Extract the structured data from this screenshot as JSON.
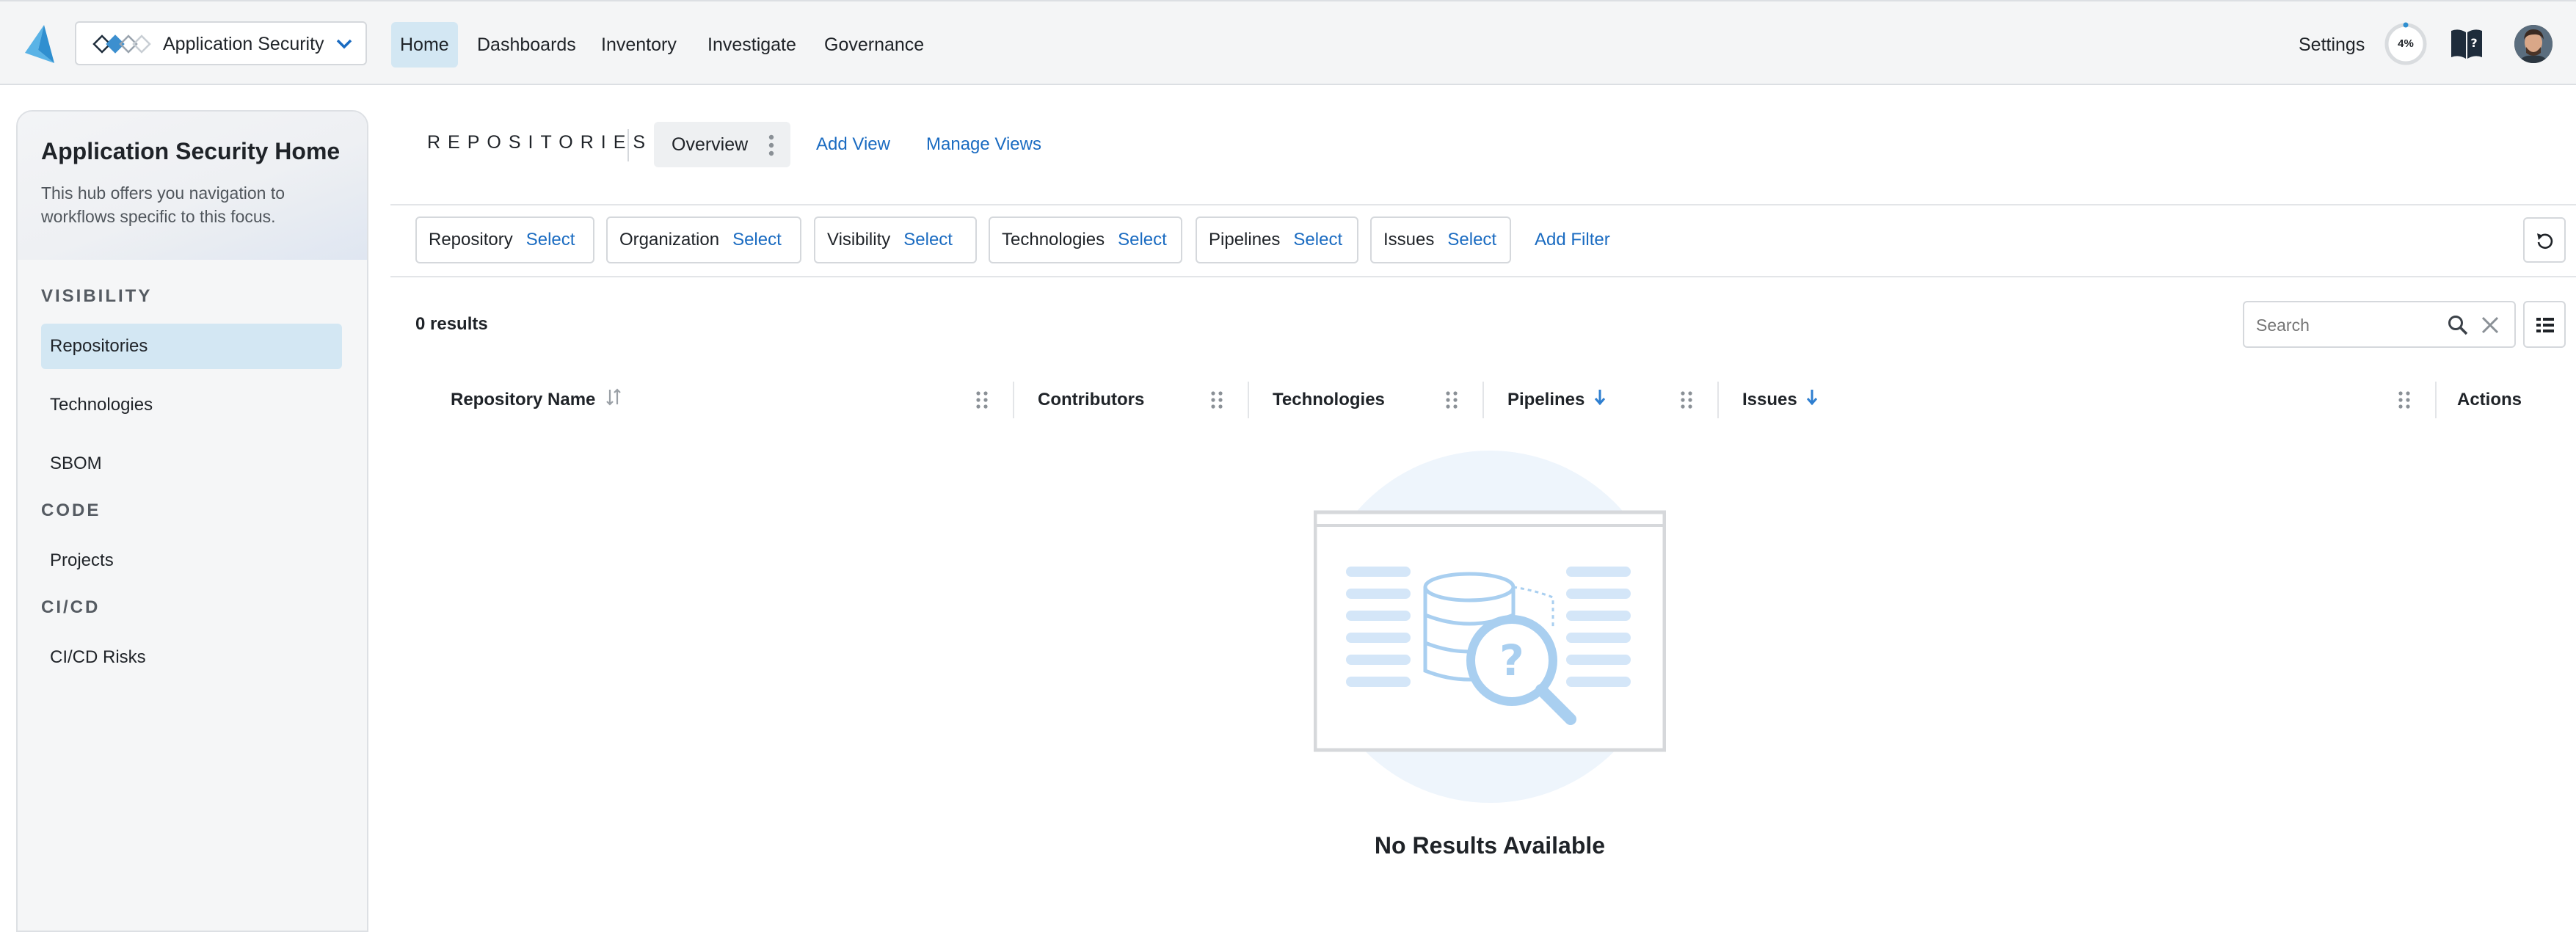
{
  "header": {
    "app_selector": "Application Security",
    "nav": [
      "Home",
      "Dashboards",
      "Inventory",
      "Investigate",
      "Governance"
    ],
    "settings": "Settings",
    "progress_label": "4%",
    "progress_value": 0.04
  },
  "sidebar": {
    "title": "Application Security Home",
    "description": "This hub offers you navigation to workflows specific to this focus.",
    "sections": {
      "visibility": "VISIBILITY",
      "code": "CODE",
      "cicd": "CI/CD"
    },
    "items": {
      "repositories": "Repositories",
      "technologies": "Technologies",
      "sbom": "SBOM",
      "projects": "Projects",
      "cicd_risks": "CI/CD Risks"
    }
  },
  "main": {
    "section_title": "REPOSITORIES",
    "tabs": {
      "overview": "Overview",
      "add_view": "Add View",
      "manage_views": "Manage Views"
    },
    "filters": [
      {
        "label": "Repository",
        "action": "Select"
      },
      {
        "label": "Organization",
        "action": "Select"
      },
      {
        "label": "Visibility",
        "action": "Select"
      },
      {
        "label": "Technologies",
        "action": "Select"
      },
      {
        "label": "Pipelines",
        "action": "Select"
      },
      {
        "label": "Issues",
        "action": "Select"
      }
    ],
    "add_filter": "Add Filter",
    "results_count": "0 results",
    "search_placeholder": "Search",
    "columns": {
      "repository_name": "Repository Name",
      "contributors": "Contributors",
      "technologies": "Technologies",
      "pipelines": "Pipelines",
      "issues": "Issues",
      "actions": "Actions"
    },
    "empty_state": "No Results Available"
  },
  "colors": {
    "accent": "#1a6bc1",
    "active_bg": "#d3e7f3",
    "illustration": "#a9cff0"
  }
}
